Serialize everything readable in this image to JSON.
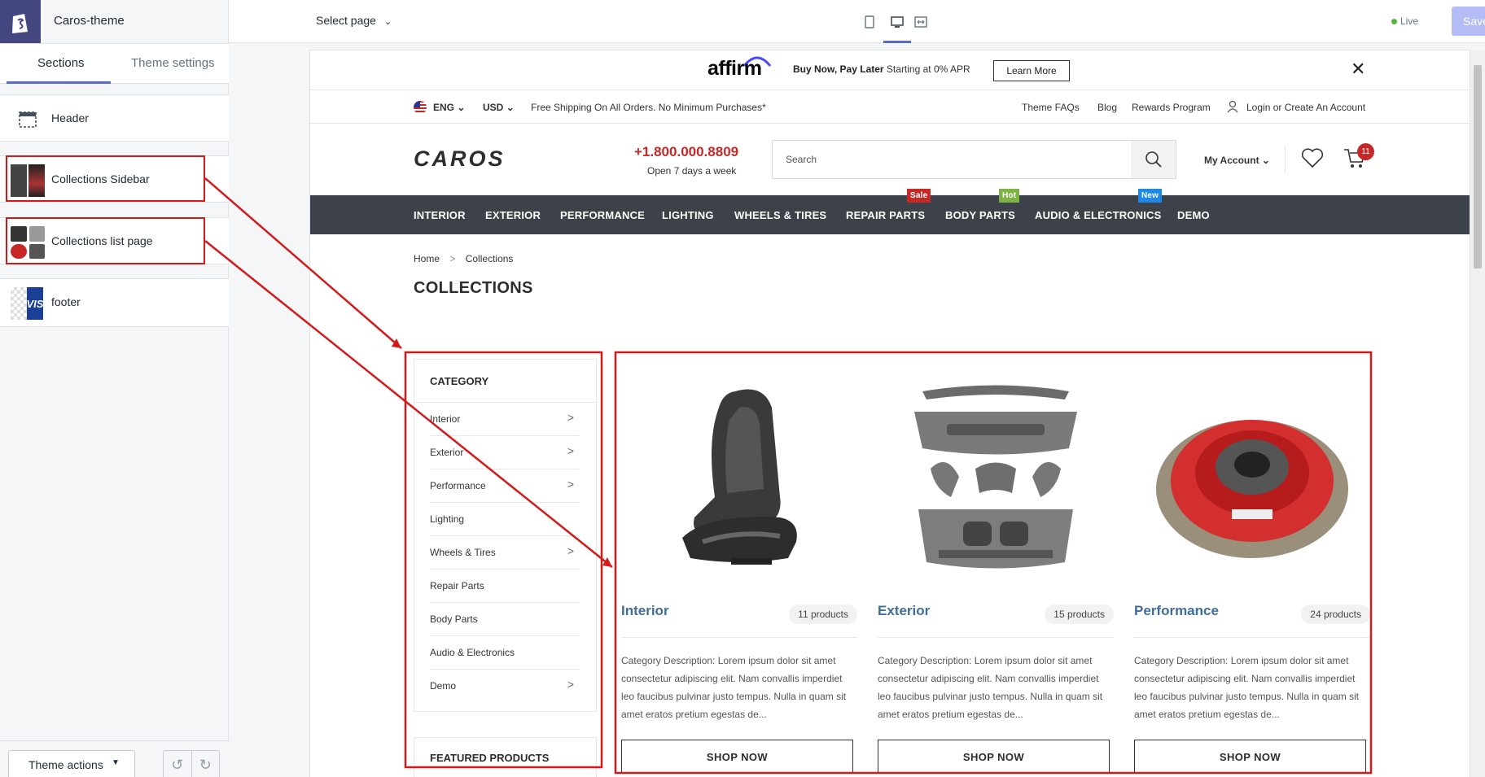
{
  "editor": {
    "theme_name": "Caros-theme",
    "tabs": [
      "Sections",
      "Theme settings"
    ],
    "sections": [
      {
        "label": "Header",
        "icon": "header-layout-icon"
      },
      {
        "label": "Collections Sidebar",
        "icon": "collections-sidebar-thumbnail"
      },
      {
        "label": "Collections list page",
        "icon": "collections-list-thumbnail"
      },
      {
        "label": "footer",
        "icon": "visa-thumbnail"
      }
    ],
    "theme_actions_label": "Theme actions",
    "select_page_label": "Select page",
    "live_label": "Live",
    "save_label": "Save"
  },
  "store": {
    "affirm": {
      "logo": "affirm",
      "text_bold": "Buy Now, Pay Later",
      "text": " Starting at 0% APR",
      "button": "Learn More"
    },
    "util": {
      "lang": "ENG",
      "currency": "USD",
      "shipping": "Free Shipping On All Orders. No Minimum Purchases*",
      "links": [
        "Theme FAQs",
        "Blog",
        "Rewards Program",
        "Login or Create An Account"
      ]
    },
    "header": {
      "logo": "CAROS",
      "phone": "+1.800.000.8809",
      "hours": "Open 7 days a week",
      "search_placeholder": "Search",
      "account": "My Account",
      "cart_count": "11"
    },
    "nav": [
      {
        "label": "INTERIOR"
      },
      {
        "label": "EXTERIOR"
      },
      {
        "label": "PERFORMANCE"
      },
      {
        "label": "LIGHTING"
      },
      {
        "label": "WHEELS & TIRES"
      },
      {
        "label": "REPAIR PARTS",
        "badge": "Sale",
        "badge_color": "#c62828"
      },
      {
        "label": "BODY PARTS",
        "badge": "Hot",
        "badge_color": "#7cb342"
      },
      {
        "label": "AUDIO & ELECTRONICS",
        "badge": "New",
        "badge_color": "#1e88e5"
      },
      {
        "label": "DEMO"
      }
    ],
    "breadcrumb": {
      "home": "Home",
      "sep": ">",
      "current": "Collections"
    },
    "page_title": "COLLECTIONS",
    "sidebar": {
      "title": "CATEGORY",
      "items": [
        {
          "label": "Interior",
          "chevron": true
        },
        {
          "label": "Exterior",
          "chevron": true
        },
        {
          "label": "Performance",
          "chevron": true
        },
        {
          "label": "Lighting",
          "chevron": false
        },
        {
          "label": "Wheels & Tires",
          "chevron": true
        },
        {
          "label": "Repair Parts",
          "chevron": false
        },
        {
          "label": "Body Parts",
          "chevron": false
        },
        {
          "label": "Audio & Electronics",
          "chevron": false
        },
        {
          "label": "Demo",
          "chevron": true
        }
      ],
      "featured_title": "FEATURED PRODUCTS"
    },
    "collections": [
      {
        "name": "Interior",
        "count": "11 products",
        "image": "car-seat-image",
        "description": "Category Description: Lorem ipsum dolor sit amet consectetur adipiscing elit. Nam convallis imperdiet leo faucibus pulvinar justo tempus. Nulla in quam sit amet eratos pretium egestas de...",
        "button": "SHOP NOW"
      },
      {
        "name": "Exterior",
        "count": "15 products",
        "image": "body-kit-image",
        "description": "Category Description: Lorem ipsum dolor sit amet consectetur adipiscing elit. Nam convallis imperdiet leo faucibus pulvinar justo tempus. Nulla in quam sit amet eratos pretium egestas de...",
        "button": "SHOP NOW"
      },
      {
        "name": "Performance",
        "count": "24 products",
        "image": "clutch-image",
        "description": "Category Description: Lorem ipsum dolor sit amet consectetur adipiscing elit. Nam convallis imperdiet leo faucibus pulvinar justo tempus. Nulla in quam sit amet eratos pretium egestas de...",
        "button": "SHOP NOW"
      }
    ]
  },
  "colors": {
    "accent": "#5c6ac4",
    "annotation_red": "#d31a1a",
    "nav_bg": "#3d4149",
    "phone_red": "#c62828",
    "collection_link": "#3f6d9b"
  }
}
